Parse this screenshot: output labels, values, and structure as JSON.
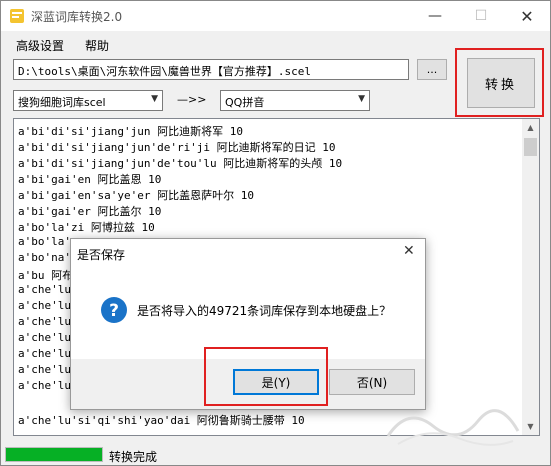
{
  "window": {
    "title": "深蓝词库转换2.0",
    "controls": {
      "minimize": "—",
      "maximize": "☐",
      "close": "✕"
    }
  },
  "menu": {
    "items": [
      "高级设置",
      "帮助"
    ]
  },
  "file": {
    "path": "D:\\tools\\桌面\\河东软件园\\魔兽世界【官方推荐】.scel",
    "browse_label": "..."
  },
  "convert_label": "转换",
  "format": {
    "from": "搜狗细胞词库scel",
    "arrow": "—>>",
    "to": "QQ拼音"
  },
  "list": {
    "lines": [
      "a'bi'di'si'jiang'jun 阿比迪斯将军 10",
      "a'bi'di'si'jiang'jun'de'ri'ji 阿比迪斯将军的日记 10",
      "a'bi'di'si'jiang'jun'de'tou'lu 阿比迪斯将军的头颅 10",
      "a'bi'gai'en 阿比盖恩 10",
      "a'bi'gai'en'sa'ye'er 阿比盖恩萨叶尔 10",
      "a'bi'gai'er 阿比盖尔 10",
      "a'bo'la'zi 阿博拉兹 10",
      "a'bo'la'z",
      "a'bo'na's",
      "a'bu 阿布",
      "a'che'lu'",
      "a'che'lu'",
      "a'che'lu'",
      "a'che'lu'",
      "a'che'lu'",
      "a'che'lu'",
      "a'che'lu'",
      "a'che'lu'si'qi'shi'yao'dai 阿彻鲁斯骑士腰带 10"
    ]
  },
  "status": {
    "progress": 1.0,
    "text": "转换完成"
  },
  "dialog": {
    "title": "是否保存",
    "close": "✕",
    "message": "是否将导入的49721条词库保存到本地硬盘上？",
    "yes_label": "是(Y)",
    "no_label": "否(N)"
  },
  "colors": {
    "accent": "#0078d7",
    "highlight": "#e02020",
    "progress": "#06b025"
  }
}
